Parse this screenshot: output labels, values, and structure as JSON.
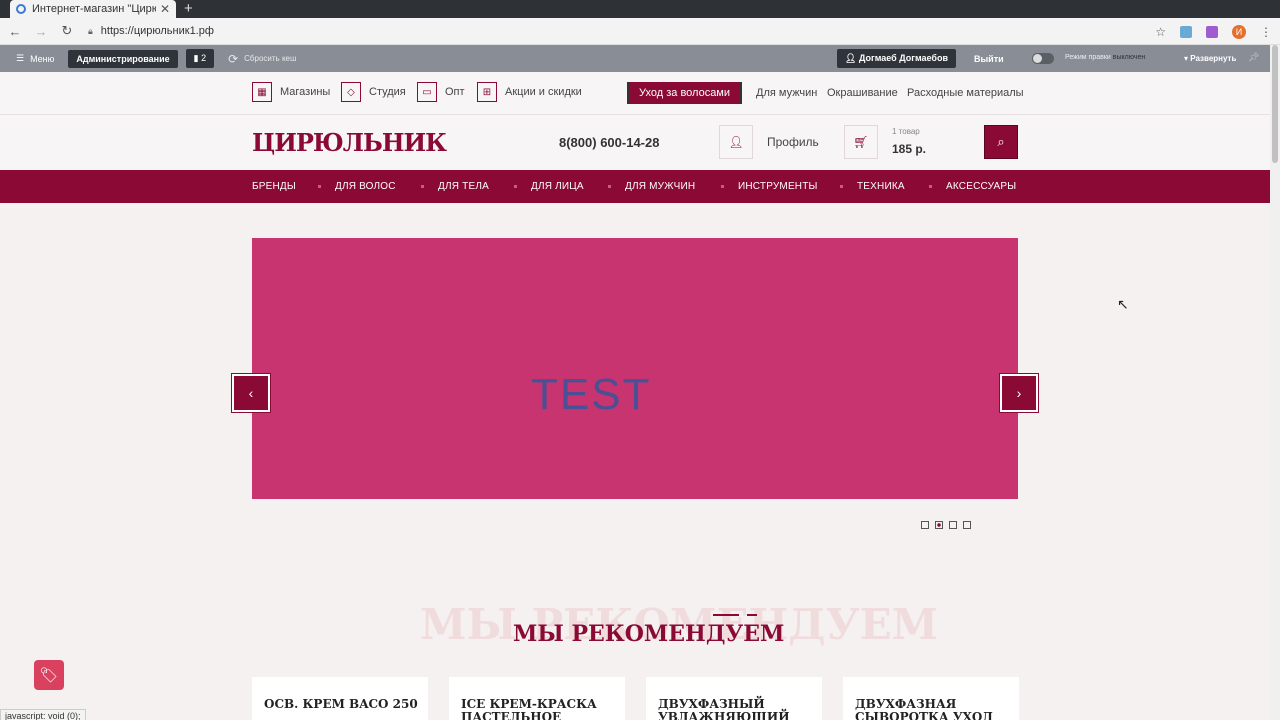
{
  "browser": {
    "tab_title": "Интернет-магазин \"Цирю",
    "url": "https://цирюльник1.рф",
    "profile_initial": "И"
  },
  "admin": {
    "menu": "Меню",
    "administration": "Администрирование",
    "count": "2",
    "clear_cache": "Сбросить кеш",
    "user": "Догмаеб Догмаебов",
    "logout": "Выйти",
    "edit_mode": "Режим правки",
    "edit_mode_state": "выключен",
    "expand": "Развернуть"
  },
  "topnav": {
    "stores": "Магазины",
    "studio": "Студия",
    "opt": "Опт",
    "promos": "Акции и скидки",
    "hair_care": "Уход за волосами",
    "for_men": "Для мужчин",
    "coloring": "Окрашивание",
    "supplies": "Расходные материалы"
  },
  "header": {
    "logo": "ЦИРЮЛЬНИК",
    "phone": "8(800) 600-14-28",
    "profile": "Профиль",
    "cart_count": "1 товар",
    "cart_sum": "185 р."
  },
  "mainnav": [
    "БРЕНДЫ",
    "ДЛЯ ВОЛОС",
    "ДЛЯ ТЕЛА",
    "ДЛЯ ЛИЦА",
    "ДЛЯ МУЖЧИН",
    "ИНСТРУМЕНТЫ",
    "ТЕХНИКА",
    "АКСЕССУАРЫ"
  ],
  "slider": {
    "text": "TEST",
    "slides": 4,
    "active": 2
  },
  "recommend": {
    "title": "МЫ РЕКОМЕНДУЕМ",
    "bg_title": "МЫ РЕКОМЕНДУЕМ",
    "products": [
      "ОСВ. КРЕМ BACO 250",
      "ICE КРЕМ-КРАСКА ПАСТЕЛЬНОЕ",
      "ДВУХФАЗНЫЙ УВЛАЖНЯЮЩИЙ",
      "ДВУХФАЗНАЯ СЫВОРОТКА УХОД"
    ]
  },
  "status_text": "javascript: void (0);",
  "colors": {
    "brand": "#8a0a35",
    "slide_bg": "#c73470",
    "slide_text": "#4b4f93"
  }
}
